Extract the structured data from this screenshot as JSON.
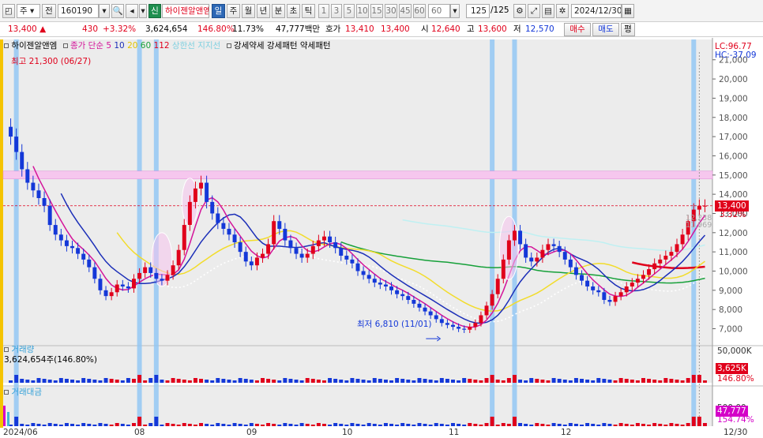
{
  "toolbar": {
    "market": "주",
    "period_toggle": "전",
    "stock_code": "160190",
    "alpha_badge": "신",
    "stock_name": "하이젠알앤엠",
    "periods": [
      "일",
      "주",
      "월",
      "년",
      "분",
      "초",
      "틱"
    ],
    "intervals": [
      "1",
      "3",
      "5",
      "10",
      "15",
      "30",
      "45",
      "60"
    ],
    "interval_value": "60",
    "count": "125",
    "count_total": "/125",
    "date": "2024/12/30"
  },
  "quote": {
    "price": "13,400",
    "change_arrow": "▲",
    "change": "430",
    "change_pct": "+3.32%",
    "volume": "3,624,654",
    "volume_ratio": "146.80%",
    "turnover": "11.73%",
    "amount": "47,777백만",
    "bid_label": "호가",
    "bid": "13,410",
    "ask": "13,400",
    "open_label": "시",
    "open": "12,640",
    "high_label": "고",
    "high": "13,600",
    "low_label": "저",
    "low": "12,570",
    "buy_button": "매수",
    "sell_button": "매도",
    "eval_button": "평"
  },
  "legend": {
    "name": "하이젠알앤엠",
    "ma_label": "종가 단순",
    "ma_values": [
      "5",
      "10",
      "20",
      "60",
      "112"
    ],
    "upper_line": "상한선",
    "support_line": "지지선",
    "pattern_items": [
      "강세약세",
      "강세패턴",
      "약세패턴"
    ],
    "max_label": "최고 21,300 (06/27)",
    "min_label": "최저 6,810 (11/01)",
    "lc": "LC:96.77",
    "hc": "HC:-37.09"
  },
  "chart_data": {
    "type": "candlestick",
    "price_axis": [
      "21,000",
      "20,000",
      "19,000",
      "18,000",
      "17,000",
      "16,000",
      "15,000",
      "14,000",
      "13,000",
      "12,000",
      "11,000",
      "10,000",
      "9,000",
      "8,000",
      "7,000"
    ],
    "price_range": [
      6200,
      21400
    ],
    "current_price_tag": "13,400",
    "current_pct_tag": "3.32%",
    "band_labels": [
      "12,238",
      "11,969"
    ],
    "x_labels": [
      "2024/06",
      "08",
      "09",
      "10",
      "11",
      "12",
      "12/30"
    ],
    "closes": [
      17000,
      16200,
      15300,
      14600,
      14200,
      13800,
      13400,
      12400,
      11900,
      11600,
      11300,
      11200,
      10900,
      10600,
      10200,
      9600,
      9000,
      8700,
      8900,
      9300,
      9200,
      9100,
      9600,
      9900,
      10200,
      9900,
      9600,
      9500,
      9800,
      10300,
      11100,
      12400,
      13600,
      14300,
      14600,
      13600,
      13000,
      12500,
      12200,
      11900,
      11500,
      11000,
      10500,
      10300,
      10700,
      10900,
      11400,
      12600,
      12200,
      11600,
      11200,
      10900,
      10700,
      10900,
      11300,
      11600,
      11800,
      11500,
      11200,
      10800,
      10600,
      10400,
      10000,
      9800,
      9600,
      9400,
      9300,
      9200,
      9000,
      8800,
      8700,
      8500,
      8300,
      8100,
      7900,
      7700,
      7500,
      7300,
      7200,
      7100,
      7000,
      6950,
      7100,
      7300,
      7700,
      8200,
      8800,
      9600,
      10600,
      11600,
      12100,
      11400,
      10700,
      10500,
      10700,
      11100,
      11400,
      11300,
      11000,
      10600,
      10200,
      9800,
      9500,
      9200,
      9000,
      8900,
      8500,
      8400,
      8700,
      8900,
      9200,
      9400,
      9600,
      9800,
      10100,
      10400,
      10600,
      10800,
      11000,
      11400,
      11900,
      12600,
      13200,
      13400,
      13400
    ],
    "ma_colors": {
      "ma5": "#d4149a",
      "ma10": "#1c2fb8",
      "ma20": "#f2dc2b",
      "ma60": "#16a039",
      "ma112": "#e0001b"
    },
    "volume_label": "거래량",
    "volume_value": "3,624,654주(146.80%)",
    "volume_axis": "50,000K",
    "volume_tag": "3,625K",
    "volume_pct": "146.80%",
    "amount_label": "거래대금",
    "amount_axis": "500,00",
    "amount_tag": "47,777",
    "amount_pct": "154.74%"
  },
  "colors": {
    "up": "#e0001b",
    "down": "#1438d8",
    "highlight_band": "#8ec5f5",
    "resistance_zone": "#f6c7ee"
  }
}
